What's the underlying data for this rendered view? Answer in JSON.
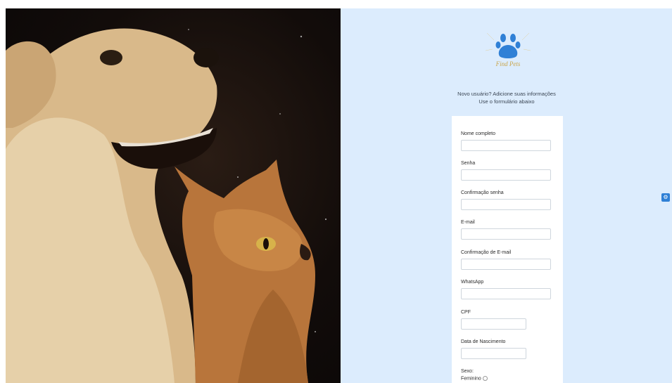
{
  "intro": {
    "line1": "Novo usuário? Adicione suas informações",
    "line2": "Use o formulário abaixo"
  },
  "logo": {
    "text": "Find Pets"
  },
  "form": {
    "fields": [
      {
        "label": "Nome completo",
        "value": ""
      },
      {
        "label": "Senha",
        "value": ""
      },
      {
        "label": "Confirmação senha",
        "value": ""
      },
      {
        "label": "E-mail",
        "value": ""
      },
      {
        "label": "Confirmação de E-mail",
        "value": ""
      },
      {
        "label": "WhatsApp",
        "value": ""
      },
      {
        "label": "CPF",
        "value": ""
      },
      {
        "label": "Data de Nascimento",
        "value": ""
      }
    ],
    "sexo_label": "Sexo:",
    "feminino_label": "Feminino"
  },
  "icons": {
    "side_button": "gear-icon",
    "logo": "paw-icon"
  }
}
